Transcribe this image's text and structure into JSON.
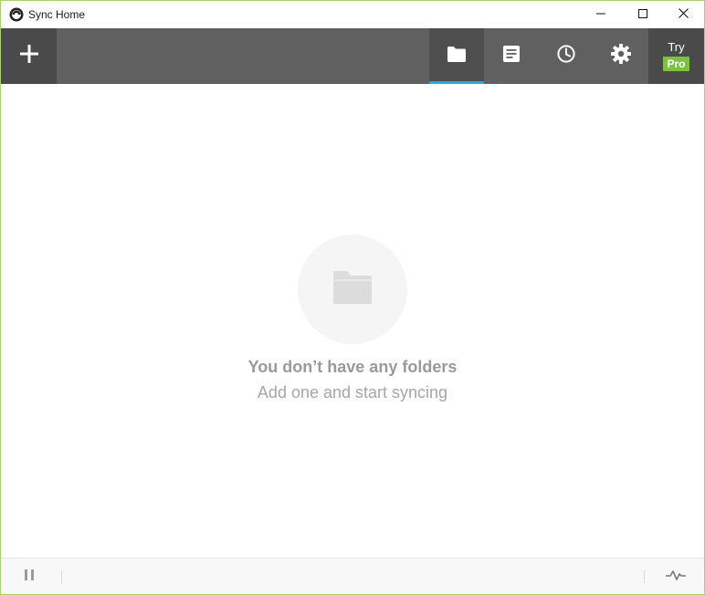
{
  "window": {
    "title": "Sync Home"
  },
  "toolbar": {
    "add_icon": "plus-icon",
    "tabs": [
      {
        "id": "folders",
        "icon": "folder-icon",
        "active": true
      },
      {
        "id": "log",
        "icon": "document-icon",
        "active": false
      },
      {
        "id": "history",
        "icon": "clock-icon",
        "active": false
      },
      {
        "id": "settings",
        "icon": "gear-icon",
        "active": false
      }
    ],
    "try_label": "Try",
    "pro_label": "Pro"
  },
  "empty_state": {
    "icon": "folder-icon",
    "title": "You don’t have any folders",
    "subtitle": "Add one and start syncing"
  },
  "statusbar": {
    "pause_icon": "pause-icon",
    "activity_icon": "activity-icon"
  },
  "colors": {
    "toolbar_bg": "#606060",
    "toolbar_dark": "#4a4a4a",
    "active_tab_indicator": "#27a9e1",
    "pro_badge": "#7bc242",
    "window_border": "#a8d26e",
    "empty_text": "#9a9a9a"
  }
}
